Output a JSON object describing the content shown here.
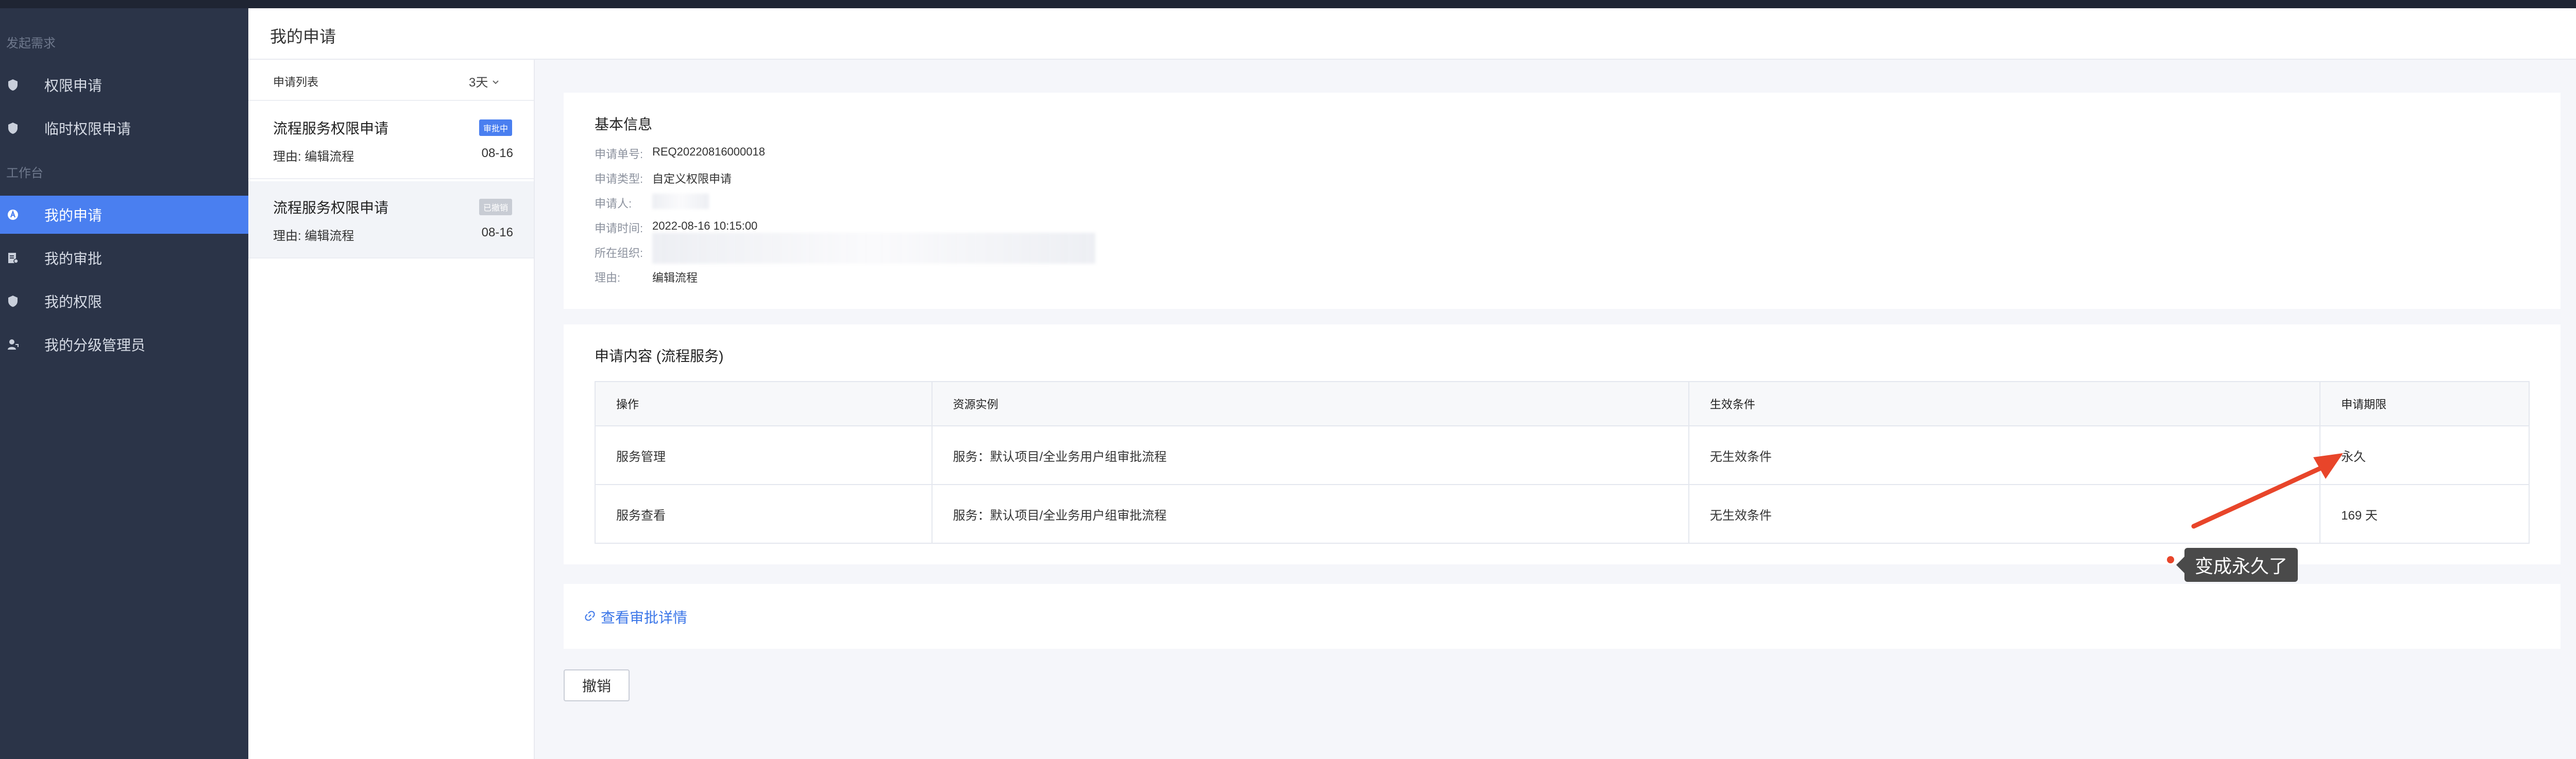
{
  "sidebar": {
    "groups": [
      "发起需求",
      "工作台"
    ],
    "items": [
      {
        "label": "权限申请",
        "icon": "shield-icon"
      },
      {
        "label": "临时权限申请",
        "icon": "shield-icon"
      },
      {
        "label": "我的申请",
        "icon": "request-icon"
      },
      {
        "label": "我的审批",
        "icon": "approval-icon"
      },
      {
        "label": "我的权限",
        "icon": "shield-icon"
      },
      {
        "label": "我的分级管理员",
        "icon": "admin-user-icon"
      }
    ]
  },
  "header": {
    "title": "我的申请"
  },
  "list": {
    "title": "申请列表",
    "filter": "3天",
    "cards": [
      {
        "title": "流程服务权限申请",
        "badge": "审批中",
        "reason": "理由:  编辑流程",
        "date": "08-16"
      },
      {
        "title": "流程服务权限申请",
        "badge": "已撤销",
        "reason": "理由:  编辑流程",
        "date": "08-16"
      }
    ]
  },
  "basic_info": {
    "title": "基本信息",
    "rows": [
      {
        "label": "申请单号:",
        "value": "REQ20220816000018"
      },
      {
        "label": "申请类型:",
        "value": "自定义权限申请"
      },
      {
        "label": "申请人:",
        "value": ""
      },
      {
        "label": "申请时间:",
        "value": "2022-08-16 10:15:00"
      },
      {
        "label": "所在组织:",
        "value": ""
      },
      {
        "label": "理由:",
        "value": "编辑流程"
      }
    ]
  },
  "content": {
    "title": "申请内容 (流程服务)",
    "columns": [
      "操作",
      "资源实例",
      "生效条件",
      "申请期限"
    ],
    "rows": [
      [
        "服务管理",
        "服务：默认项目/全业务用户组审批流程",
        "无生效条件",
        "永久"
      ],
      [
        "服务查看",
        "服务：默认项目/全业务用户组审批流程",
        "无生效条件",
        "169 天"
      ]
    ]
  },
  "link": {
    "label": "查看审批详情",
    "icon": "link-icon"
  },
  "cancel_button": "撤销",
  "annotation": {
    "text": "变成永久了",
    "color": "#e8452a"
  },
  "colors": {
    "sidebar_bg": "#2b3448",
    "active": "#4a7ff0",
    "link": "#3b76e8"
  }
}
